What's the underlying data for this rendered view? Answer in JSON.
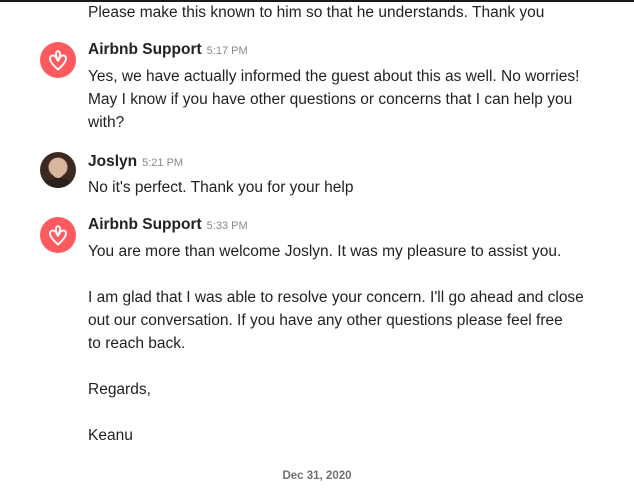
{
  "colors": {
    "airbnb_brand": "#ff5a5f",
    "text": "#222222",
    "timestamp": "#8a8a8a"
  },
  "previous_message_tail": "Please make this known to him so that he understands. Thank you",
  "messages": [
    {
      "sender": "Airbnb Support",
      "time": "5:17 PM",
      "avatar_icon": "airbnb-logo-icon",
      "lines": [
        "Yes, we have actually informed the guest about this as well. No worries!",
        "May I know if you have other questions or concerns that I can help you",
        "with?"
      ]
    },
    {
      "sender": "Joslyn",
      "time": "5:21 PM",
      "avatar_icon": "user-photo-avatar",
      "lines": [
        "No it's perfect. Thank you for your help"
      ]
    },
    {
      "sender": "Airbnb Support",
      "time": "5:33 PM",
      "avatar_icon": "airbnb-logo-icon",
      "lines": [
        "You are more than welcome Joslyn. It was my pleasure to assist you.",
        "I am glad that I was able to resolve your concern. I'll go ahead and close",
        "out our conversation. If you have any other questions please feel free",
        "to reach back.",
        "Regards,",
        "Keanu"
      ]
    }
  ],
  "date_separator": "Dec 31, 2020"
}
